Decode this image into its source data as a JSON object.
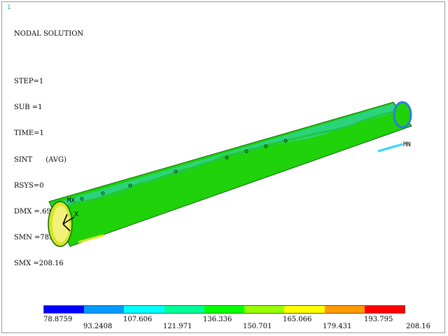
{
  "window": {
    "number": "1"
  },
  "result": {
    "title": "NODAL SOLUTION",
    "lines": [
      "STEP=1",
      "SUB =1",
      "TIME=1",
      "SINT      (AVG)",
      "RSYS=0",
      "DMX =.699536",
      "SMN =78.8759",
      "SMX =208.16"
    ]
  },
  "labels": {
    "mx": "MX",
    "mn": "MN",
    "x_axis": "X"
  },
  "legend": {
    "colors": [
      "#0000ff",
      "#0099ff",
      "#00ffff",
      "#00ff99",
      "#00ff00",
      "#99ff00",
      "#ffff00",
      "#ff9900",
      "#ff0000"
    ],
    "values_top": [
      "78.8759",
      "107.606",
      "136.336",
      "165.066",
      "193.795"
    ],
    "values_bottom": [
      "93.2408",
      "121.971",
      "150.701",
      "179.431",
      "208.16"
    ]
  }
}
